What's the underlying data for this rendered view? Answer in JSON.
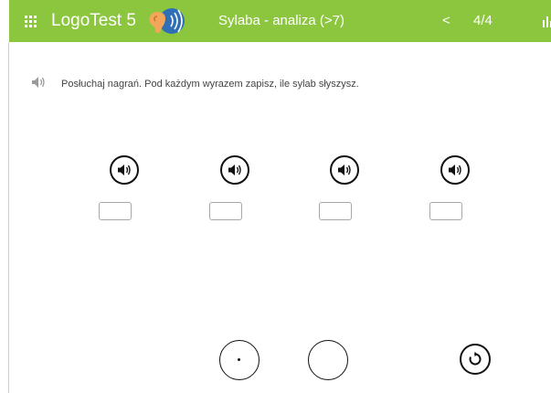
{
  "header": {
    "app_title": "LogoTest 5",
    "exercise_title": "Sylaba - analiza (>7)",
    "prev_label": "<",
    "page_counter": "4/4",
    "bar_color": "#8cc63f"
  },
  "instruction": {
    "text": "Posłuchaj nagrań. Pod każdym wyrazem zapisz, ile sylab słyszysz.",
    "icon": "speaker-icon"
  },
  "words": [
    {
      "icon": "speaker-icon",
      "answer": ""
    },
    {
      "icon": "speaker-icon",
      "answer": ""
    },
    {
      "icon": "speaker-icon",
      "answer": ""
    },
    {
      "icon": "speaker-icon",
      "answer": ""
    }
  ],
  "footer": {
    "icons": [
      "dot-button",
      "empty-circle-button",
      "reset-icon"
    ]
  }
}
